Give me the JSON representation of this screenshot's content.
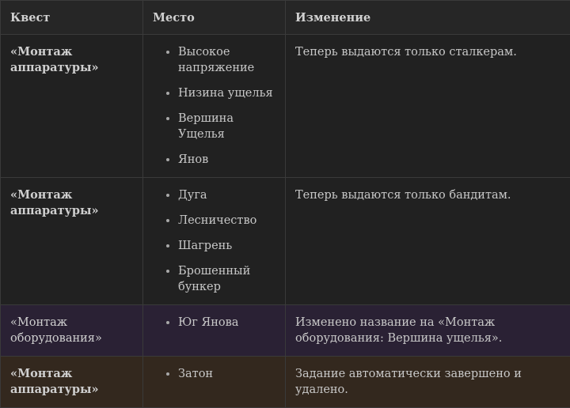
{
  "table": {
    "headers": [
      "Квест",
      "Место",
      "Изменение"
    ],
    "rows": [
      {
        "quest": "«Монтаж аппаратуры»",
        "places": [
          "Высокое напряжение",
          "Низина ущелья",
          "Вершина Ущелья",
          "Янов"
        ],
        "change": "Теперь выдаются только сталкерам.",
        "row_color": "#212121"
      },
      {
        "quest": "«Монтаж аппаратуры»",
        "places": [
          "Дуга",
          "Лесничество",
          "Шагрень",
          "Брошенный бункер"
        ],
        "change": "Теперь выдаются только бандитам.",
        "row_color": "#212121"
      },
      {
        "quest": "«Монтаж оборудования»",
        "places": [
          "Юг Янова"
        ],
        "change": "Изменено название на «Монтаж оборудования: Вершина ущелья».",
        "row_color": "#2a2134"
      },
      {
        "quest": "«Монтаж аппаратуры»",
        "places": [
          "Затон"
        ],
        "change": "Задание автоматически завершено и удалено.",
        "row_color": "#33281e"
      }
    ]
  }
}
